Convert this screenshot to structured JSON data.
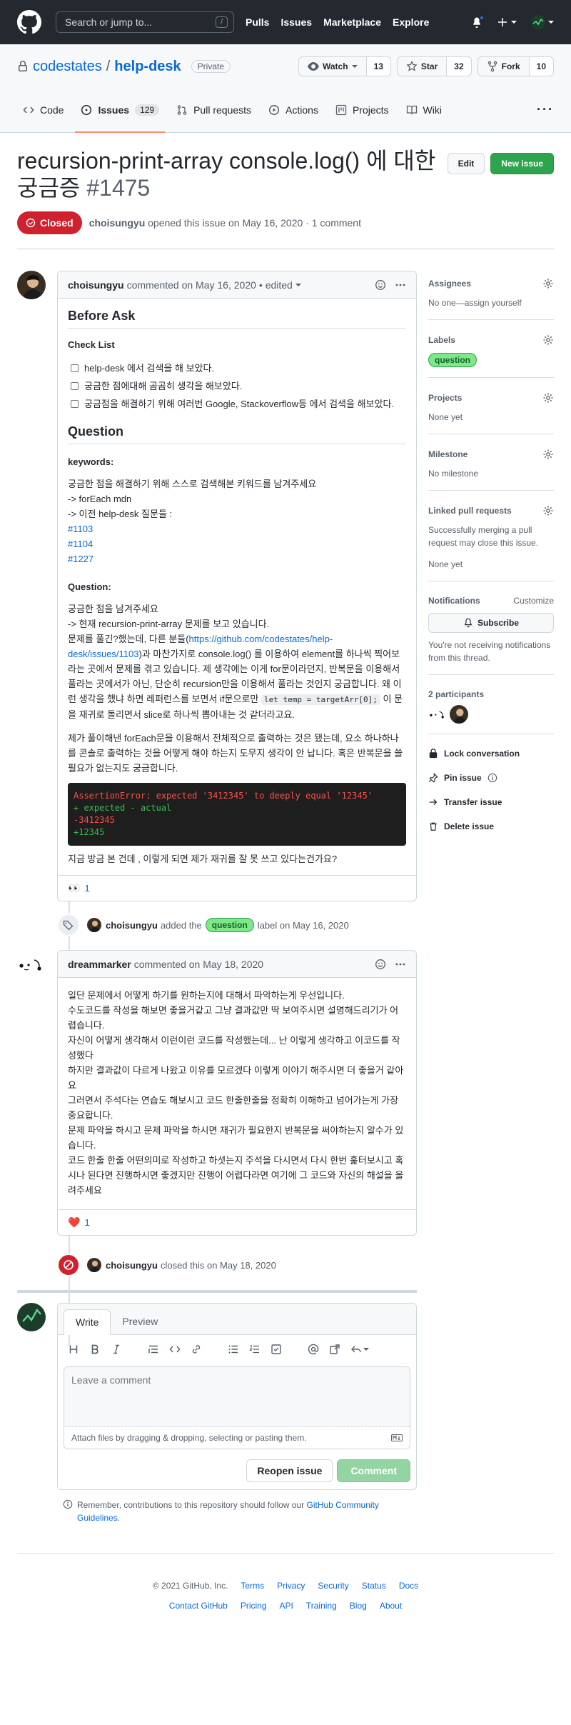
{
  "header": {
    "search_placeholder": "Search or jump to...",
    "search_key": "/",
    "nav": [
      "Pulls",
      "Issues",
      "Marketplace",
      "Explore"
    ]
  },
  "repo": {
    "owner": "codestates",
    "separator": "/",
    "name": "help-desk",
    "visibility": "Private",
    "watch": {
      "label": "Watch",
      "count": "13"
    },
    "star": {
      "label": "Star",
      "count": "32"
    },
    "fork": {
      "label": "Fork",
      "count": "10"
    },
    "tabs": [
      {
        "label": "Code",
        "icon": "code-icon"
      },
      {
        "label": "Issues",
        "icon": "issue-icon",
        "counter": "129"
      },
      {
        "label": "Pull requests",
        "icon": "pull-request-icon"
      },
      {
        "label": "Actions",
        "icon": "play-icon"
      },
      {
        "label": "Projects",
        "icon": "project-icon"
      },
      {
        "label": "Wiki",
        "icon": "book-icon"
      }
    ],
    "more": "···"
  },
  "issue": {
    "title": "recursion-print-array console.log() 에 대한 궁금증",
    "number": "#1475",
    "edit_label": "Edit",
    "new_issue_label": "New issue",
    "state": "Closed",
    "author": "choisungyu",
    "meta": "opened this issue on May 16, 2020 · 1 comment"
  },
  "comment1": {
    "author": "choisungyu",
    "meta": "commented on May 16, 2020",
    "edited": "• edited",
    "h_before": "Before Ask",
    "h_checklist": "Check List",
    "checks": [
      "help-desk 에서 검색을 해 보았다.",
      "궁금한 점에대해 곰곰히 생각을 해보았다.",
      "궁금점을 해결하기 위해 여러번 Google, Stackoverflow등 에서 검색을 해보았다."
    ],
    "h_question": "Question",
    "h_keywords": "keywords:",
    "kw_line1": "궁금한 점을 해결하기 위해 스스로 검색해본 키워드를 남겨주세요",
    "kw_line2": "-> forEach mdn",
    "kw_line3": "-> 이전 help-desk 질문들 :",
    "links": [
      "#1103",
      "#1104",
      "#1227"
    ],
    "h_question2": "Question:",
    "q_line1": "궁금한 점을 남겨주세요",
    "q_line2": "-> 현재 recursion-print-array 문제를 보고 있습니다.",
    "q_p1_a": "문제를 풀긴?했는데, 다른 분들(",
    "q_link": "https://github.com/codestates/help-desk/issues/1103",
    "q_p1_b": ")과 마찬가지로 console.log() 를 이용하여 element를 하나씩 찍어보라는 곳에서 문제를 겪고 있습니다. 제 생각에는 이게 for문이라던지, 반복문을 이용해서 풀라는 곳에서가 아닌, 단순히 recursion만을 이용해서 풀라는 것인지 궁금합니다. 왜 이런 생각을 했냐 하면 레퍼런스를 보면서 if문으로만 ",
    "q_code": "let temp = targetArr[0];",
    "q_p1_c": " 이 문을 재귀로 돌리면서 slice로 하나씩 뽑아내는 것 같더라고요.",
    "q_p2": "제가 풀이해낸 forEach문을 이용해서 전체적으로 출력하는 것은 됐는데, 요소 하나하나를 콘솔로 출력하는 것을 어떻게 해야 하는지 도무지 생각이 안 납니다. 혹은 반복문을 쓸 필요가 없는지도 궁금합니다.",
    "code_lines": [
      {
        "text": "AssertionError: expected '3412345' to deeply equal '12345'",
        "color": "red"
      },
      {
        "text": "+ expected - actual",
        "color": "green"
      },
      {
        "text": " ",
        "color": "none"
      },
      {
        "text": "-3412345",
        "color": "red"
      },
      {
        "text": "+12345",
        "color": "green"
      }
    ],
    "q_last": "지금 방금 본 건데 , 이렇게 되면 제가 재귀를 잘 못 쓰고 있다는건가요?",
    "reaction": {
      "emoji": "👀",
      "count": "1"
    }
  },
  "event_label": {
    "author": "choisungyu",
    "text_a": "added the",
    "label": "question",
    "text_b": "label on May 16, 2020"
  },
  "comment2": {
    "author": "dreammarker",
    "meta": "commented on May 18, 2020",
    "paragraphs": [
      "일단 문제에서 어떻게 하기를 원하는지에 대해서 파악하는게 우선입니다.",
      "수도코드를 작성을 해보면 좋을거같고 그냥 결과값만 딱 보여주시면 설명해드리기가 어렵습니다.",
      "자신이 어떻게 생각해서 이런이런 코드를 작성했는데... 난 이렇게 생각하고 이코드를 작성했다",
      "하지만 결과값이 다르게 나왔고 이유를 모르겠다 이렇게 이야기 해주시면 더 좋을거 같아요",
      "그러면서 주석다는 연습도 해보시고 코드 한줄한줄을 정확히 이해하고 넘어가는게 가장 중요합니다.",
      "문제 파악을 하시고 문제 파악을 하시면 재귀가 필요한지 반복문을 써야하는지 알수가 있습니다.",
      "코드 한줄 한줄 어떤의미로 작성하고 하셧는지 주석을 다시면서 다시 한번 훑터보시고 혹시나 된다면 진행하시면 좋겠지만 진행이 어렵다라면 여기에 그 코드와 자신의 해설을 올려주세요"
    ],
    "reaction": {
      "emoji": "❤️",
      "count": "1"
    }
  },
  "event_closed": {
    "author": "choisungyu",
    "text": "closed this on May 18, 2020"
  },
  "form": {
    "tab_write": "Write",
    "tab_preview": "Preview",
    "placeholder": "Leave a comment",
    "attach": "Attach files by dragging & dropping, selecting or pasting them.",
    "reopen": "Reopen issue",
    "comment": "Comment",
    "remember_a": "Remember, contributions to this repository should follow our ",
    "remember_link": "GitHub Community Guidelines",
    "remember_b": "."
  },
  "sidebar": {
    "assignees_title": "Assignees",
    "assignees_val": "No one—assign yourself",
    "labels_title": "Labels",
    "labels_val": "question",
    "projects_title": "Projects",
    "projects_val": "None yet",
    "milestone_title": "Milestone",
    "milestone_val": "No milestone",
    "linked_title": "Linked pull requests",
    "linked_desc": "Successfully merging a pull request may close this issue.",
    "linked_val": "None yet",
    "notif_title": "Notifications",
    "notif_customize": "Customize",
    "subscribe": "Subscribe",
    "notif_desc": "You're not receiving notifications from this thread.",
    "participants": "2 participants",
    "lock": "Lock conversation",
    "pin": "Pin issue",
    "transfer": "Transfer issue",
    "delete": "Delete issue"
  },
  "footer": {
    "copyright": "© 2021 GitHub, Inc.",
    "row1": [
      "Terms",
      "Privacy",
      "Security",
      "Status",
      "Docs"
    ],
    "row2": [
      "Contact GitHub",
      "Pricing",
      "API",
      "Training",
      "Blog",
      "About"
    ]
  },
  "colors": {
    "header_bg": "#24292f",
    "closed_red": "#cf222e",
    "green": "#2da44e",
    "link": "#0969da"
  }
}
